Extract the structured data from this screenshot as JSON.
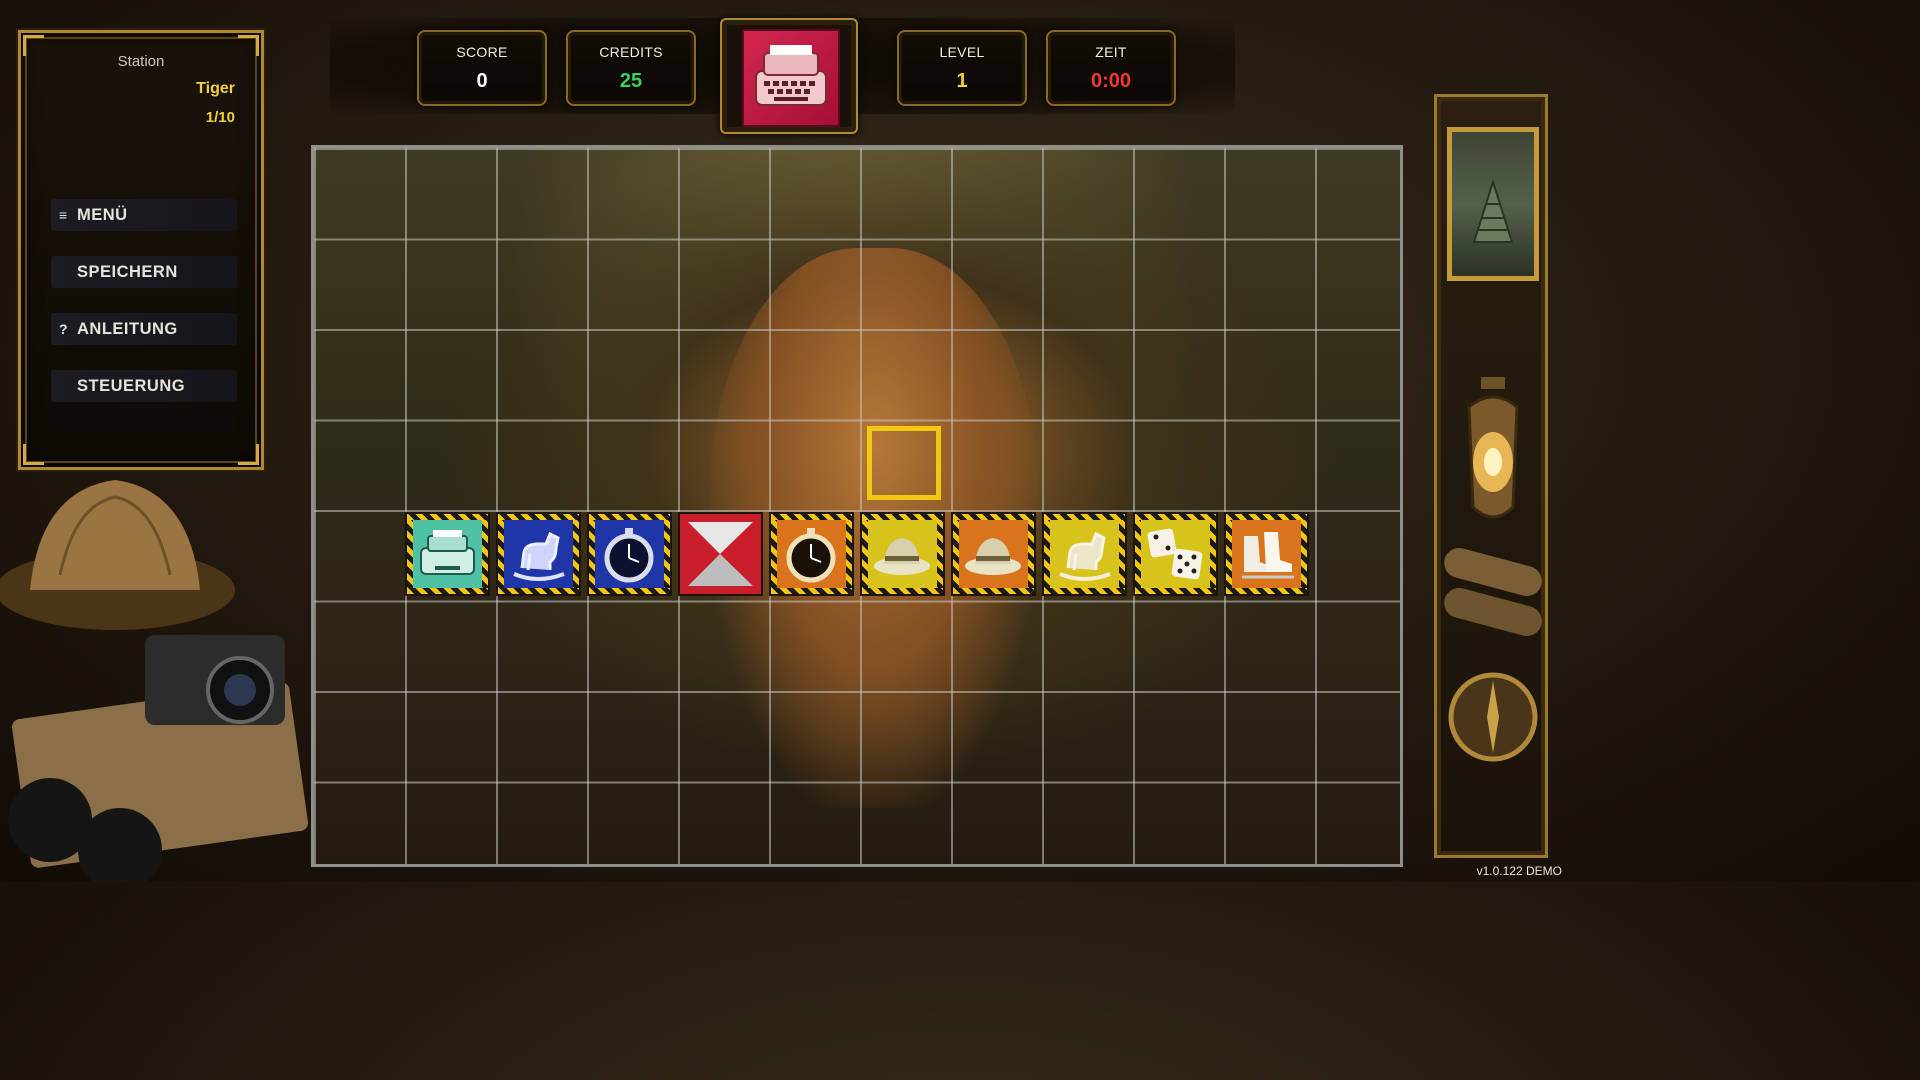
{
  "sidebar": {
    "station_label": "Station",
    "station_name": "Tiger",
    "station_progress": "1/10",
    "buttons": [
      {
        "icon": "≡",
        "label": "MENÜ",
        "icon_name": "hamburger-menu-icon"
      },
      {
        "icon": "",
        "label": "SPEICHERN"
      },
      {
        "icon": "?",
        "label": "ANLEITUNG",
        "icon_name": "question-icon"
      },
      {
        "icon": "",
        "label": "STEUERUNG"
      }
    ]
  },
  "hud": {
    "score": {
      "label": "SCORE",
      "value": "0"
    },
    "credits": {
      "label": "CREDITS",
      "value": "25"
    },
    "level": {
      "label": "LEVEL",
      "value": "1"
    },
    "time": {
      "label": "ZEIT",
      "value": "0:00"
    },
    "next_item_icon": "typewriter-icon"
  },
  "board": {
    "columns": 12,
    "rows": 8,
    "background": "tiger in jungle",
    "cursor": {
      "row": 3,
      "col": 6
    },
    "tiles": [
      {
        "col": 1,
        "item": "typewriter",
        "bg": "#4fc2a6",
        "hazard": true
      },
      {
        "col": 2,
        "item": "rocking-horse",
        "bg": "#2036a8",
        "hazard": true
      },
      {
        "col": 3,
        "item": "stopwatch",
        "bg": "#2036a8",
        "hazard": true
      },
      {
        "col": 4,
        "item": "hourglass-tile",
        "bg": "#c81e2c",
        "hazard": false
      },
      {
        "col": 5,
        "item": "stopwatch",
        "bg": "#d9731c",
        "hazard": true
      },
      {
        "col": 6,
        "item": "hat",
        "bg": "#d8c21c",
        "hazard": true
      },
      {
        "col": 7,
        "item": "hat",
        "bg": "#d9731c",
        "hazard": true
      },
      {
        "col": 8,
        "item": "rocking-horse",
        "bg": "#d8c21c",
        "hazard": true
      },
      {
        "col": 9,
        "item": "dice",
        "bg": "#d8c21c",
        "hazard": true
      },
      {
        "col": 10,
        "item": "skates",
        "bg": "#d9731c",
        "hazard": true
      }
    ]
  },
  "colors": {
    "gold": "#b08a2e",
    "score": "#ffffff",
    "credits": "#39d25a",
    "level": "#f2cf32",
    "time": "#f23b2b",
    "cursor": "#f1c912"
  },
  "version": "v1.0.122 DEMO"
}
